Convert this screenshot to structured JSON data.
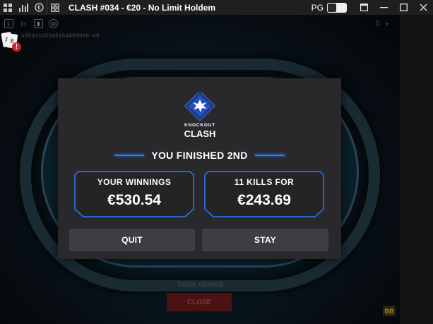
{
  "titlebar": {
    "title": "CLASH #034 - €20 - No Limit Holdem",
    "pg_label": "PG",
    "icons": [
      "lobby-grid-icon",
      "stats-bars-icon",
      "euro-icon",
      "layout-icon"
    ]
  },
  "table": {
    "hand_id": "#9594165568164889996-69",
    "status_text": "Table closed",
    "close_label": "CLOSE",
    "bb_badge": "BB",
    "alert_mark": "!",
    "cards": [
      "A",
      "8"
    ]
  },
  "dialog": {
    "logo_top": "KNOCKOUT",
    "logo_bottom": "CLASH",
    "headline": "YOU FINISHED 2ND",
    "winnings_label": "YOUR WINNINGS",
    "winnings_value": "€530.54",
    "kills_label": "11 KILLS FOR",
    "kills_value": "€243.69",
    "quit_label": "QUIT",
    "stay_label": "STAY"
  },
  "colors": {
    "accent_blue": "#2b7bff",
    "dialog_bg": "#29292c",
    "button_bg": "#3d3d42",
    "close_red": "#4a1212"
  }
}
